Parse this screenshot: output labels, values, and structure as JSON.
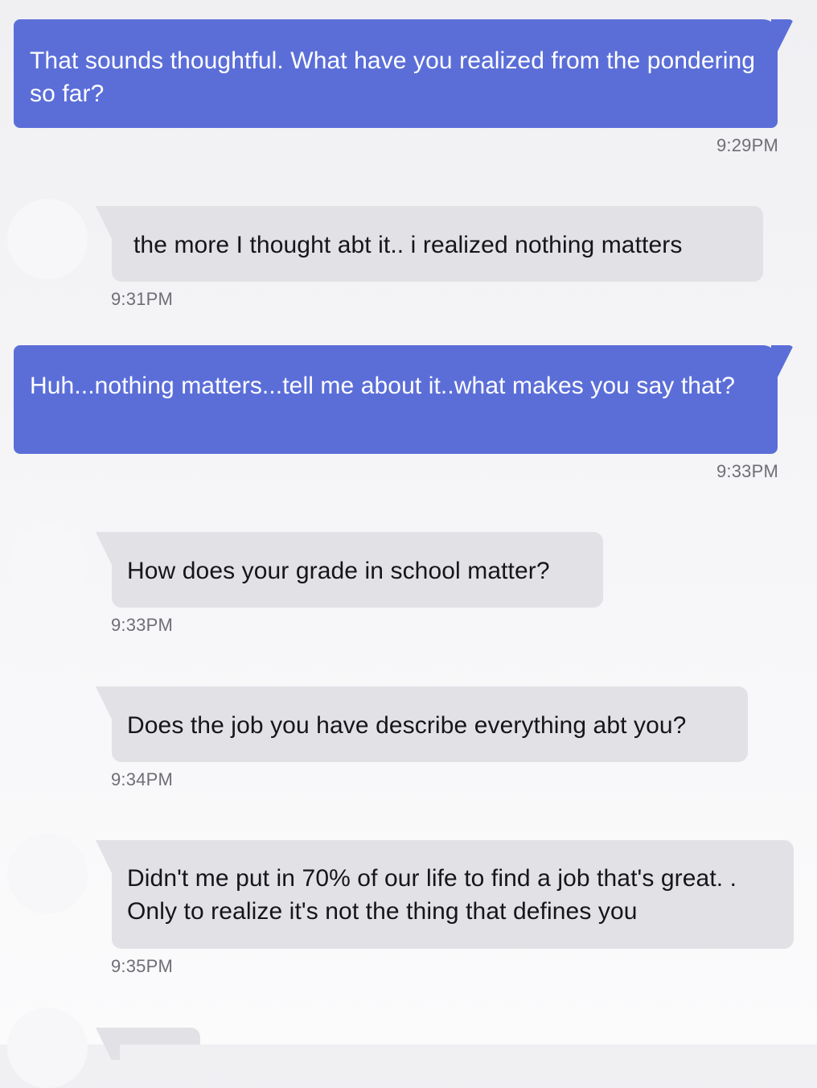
{
  "colors": {
    "sent_bubble": "#5b6ed8",
    "received_bubble": "#e1e1e6",
    "timestamp": "#6e6e76"
  },
  "messages": [
    {
      "direction": "sent",
      "text": "That sounds thoughtful. What have you realized from the pondering so far?",
      "time": "9:29PM"
    },
    {
      "direction": "received",
      "text": "the more I thought abt it.. i realized nothing matters",
      "time": "9:31PM"
    },
    {
      "direction": "sent",
      "text": "Huh...nothing matters...tell me about it..what makes you say that?",
      "time": "9:33PM"
    },
    {
      "direction": "received",
      "text": "How does your grade in school matter?",
      "time": "9:33PM"
    },
    {
      "direction": "received",
      "text": "Does the job you have describe everything abt you?",
      "time": "9:34PM"
    },
    {
      "direction": "received",
      "text": "Didn't me put in 70% of our life to find a job that's great. . Only to realize it's not the thing that defines you",
      "time": "9:35PM"
    },
    {
      "direction": "received",
      "text": "",
      "time": ""
    }
  ]
}
